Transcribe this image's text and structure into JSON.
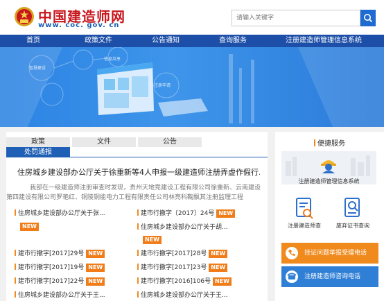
{
  "header": {
    "logo_cn": "中国建造师网",
    "logo_en": "www. coc. gov. cn",
    "search_placeholder": "请输入关键字"
  },
  "nav": {
    "items": [
      "首页",
      "政策文件",
      "公告通知",
      "查询服务",
      "注册建造师管理信息系统"
    ]
  },
  "banner": {
    "labels": [
      "智慧建设",
      "信息共享",
      "注册申请"
    ]
  },
  "main": {
    "tabs": [
      "政策",
      "文件",
      "公告"
    ],
    "active_tab": "处罚通报",
    "headline": "住房城乡建设部办公厅关于徐重新等4人申报一级建造师注册弄虚作假行...",
    "summary": "我部在一级建造师注册审查时发现，贵州天地竞建设工程有限公司徐重新、云南建设第四建设有限公司罗艳红、铜陵铜能电力工程有限责任公司林亮科鞠飘其注册监理工程",
    "items": [
      {
        "text": "住房城乡建设部办公厅关于张...",
        "new": true
      },
      {
        "text": "建市行撤字〔2017〕24号",
        "new": true
      },
      {
        "text": "住房城乡建设部办公厅关于胡...",
        "new": true
      },
      {
        "text": "建市行撤字[2017]29号",
        "new": true
      },
      {
        "text": "建市行撤字[2017]28号",
        "new": true
      },
      {
        "text": "建市行撤字[2017]19号",
        "new": true
      },
      {
        "text": "建市行撤字[2017]23号",
        "new": true
      },
      {
        "text": "建市行撤字[2017]22号",
        "new": true
      },
      {
        "text": "建市行撤字[2016]106号",
        "new": true
      },
      {
        "text": "住房城乡建设部办公厅关于王...",
        "new": false
      },
      {
        "text": "住房城乡建设部办公厅关于王...",
        "new": false
      }
    ],
    "new_label": "NEW"
  },
  "sidebar": {
    "title": "便捷服务",
    "system_label": "注册建造师管理信息系统",
    "card1_label": "注册建造师查",
    "card2_label": "废弃证书查询",
    "btn1_label": "挂证问题举报受理电话",
    "btn2_label": "注册建造师咨询电话"
  },
  "colors": {
    "brand_blue": "#1d4fa8",
    "accent_orange": "#f07d1a",
    "logo_red": "#c8161d"
  }
}
